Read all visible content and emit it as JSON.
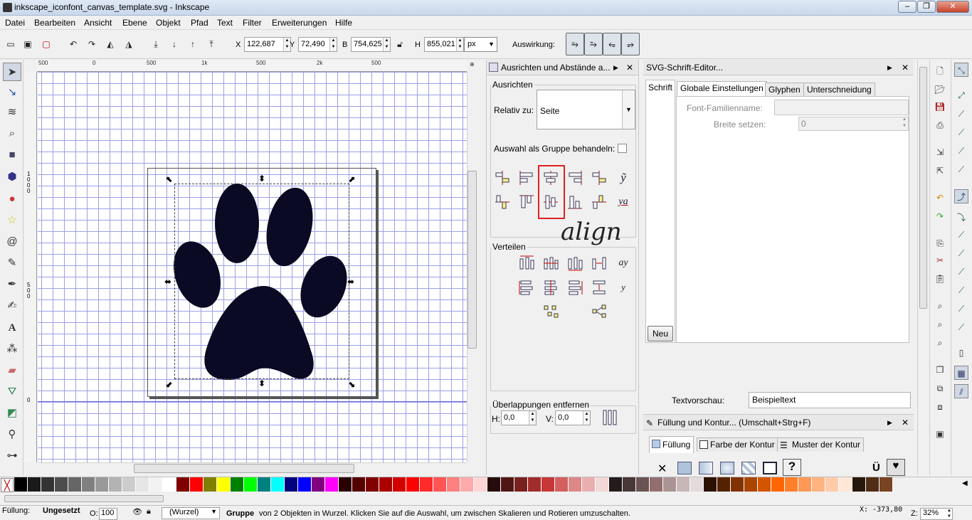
{
  "window": {
    "title": "inkscape_iconfont_canvas_template.svg - Inkscape",
    "controls": [
      "–",
      "❐",
      "✕"
    ]
  },
  "menu": [
    "Datei",
    "Bearbeiten",
    "Ansicht",
    "Ebene",
    "Objekt",
    "Pfad",
    "Text",
    "Filter",
    "Erweiterungen",
    "Hilfe"
  ],
  "toolctrl": {
    "x_label": "X",
    "x_value": "122,687",
    "y_label": "Y",
    "y_value": "72,490",
    "w_label": "B",
    "w_value": "754,625",
    "h_label": "H",
    "h_value": "855,021",
    "unit": "px",
    "auswirkung_label": "Auswirkung:"
  },
  "ruler": {
    "top_ticks": [
      "500",
      "0",
      "500",
      "1k",
      "500",
      "2k",
      "500"
    ],
    "left_ticks": [
      "1000",
      "500",
      "0"
    ]
  },
  "align_dock": {
    "title": "Ausrichten und Abstände a...",
    "ausrichten_label": "Ausrichten",
    "relativ_label": "Relativ zu:",
    "relativ_value": "Seite",
    "group_label": "Auswahl als Gruppe behandeln:",
    "verteilen_label": "Verteilen",
    "overlap_label": "Überlappungen entfernen",
    "h_label": "H:",
    "h_value": "0,0",
    "v_label": "V:",
    "v_value": "0,0",
    "annotation": "align"
  },
  "font_editor": {
    "title": "SVG-Schrift-Editor...",
    "list_header": "Schrift",
    "tabs": [
      "Globale Einstellungen",
      "Glyphen",
      "Unterschneidung"
    ],
    "family_label": "Font-Familienname:",
    "family_value": "",
    "width_label": "Breite setzen:",
    "width_value": "0",
    "new_button": "Neu",
    "preview_label": "Textvorschau:",
    "preview_value": "Beispieltext"
  },
  "fill_dock": {
    "title": "Füllung und Kontur... (Umschalt+Strg+F)",
    "tabs": [
      "Füllung",
      "Farbe der Kontur",
      "Muster der Kontur"
    ]
  },
  "status": {
    "fill_label": "Füllung:",
    "fill_value": "Ungesetzt",
    "opacity_label": "O:",
    "opacity_value": "100",
    "layer_value": "(Wurzel)",
    "message_bold": "Gruppe",
    "message": "von 2 Objekten in Wurzel. Klicken Sie auf die Auswahl, um zwischen Skalieren und Rotieren umzuschalten.",
    "coords": "X: -373,80",
    "zoom_label": "Z:",
    "zoom_value": "32%"
  },
  "palette": [
    "#000000",
    "#1a1a1a",
    "#333333",
    "#4d4d4d",
    "#666666",
    "#808080",
    "#999999",
    "#b3b3b3",
    "#cccccc",
    "#e6e6e6",
    "#f2f2f2",
    "#ffffff",
    "#800000",
    "#ff0000",
    "#808000",
    "#ffff00",
    "#008000",
    "#00ff00",
    "#008080",
    "#00ffff",
    "#000080",
    "#0000ff",
    "#800080",
    "#ff00ff",
    "#2b0000",
    "#550000",
    "#800000",
    "#aa0000",
    "#d40000",
    "#ff0000",
    "#ff2a2a",
    "#ff5555",
    "#ff8080",
    "#ffaaaa",
    "#ffd5d5",
    "#280b0b",
    "#501616",
    "#782121",
    "#a02c2c",
    "#c83737",
    "#d35f5f",
    "#de8787",
    "#e9afaf",
    "#f4d7d7",
    "#241c1c",
    "#483737",
    "#6c5353",
    "#916f6f",
    "#ac9393",
    "#c8b7b7",
    "#e3dbdb",
    "#2b1100",
    "#552200",
    "#803300",
    "#aa4400",
    "#d45500",
    "#ff6600",
    "#ff7f2a",
    "#ff9955",
    "#ffb380",
    "#ffccaa",
    "#ffe6d5",
    "#28170b",
    "#502d16",
    "#784421"
  ]
}
